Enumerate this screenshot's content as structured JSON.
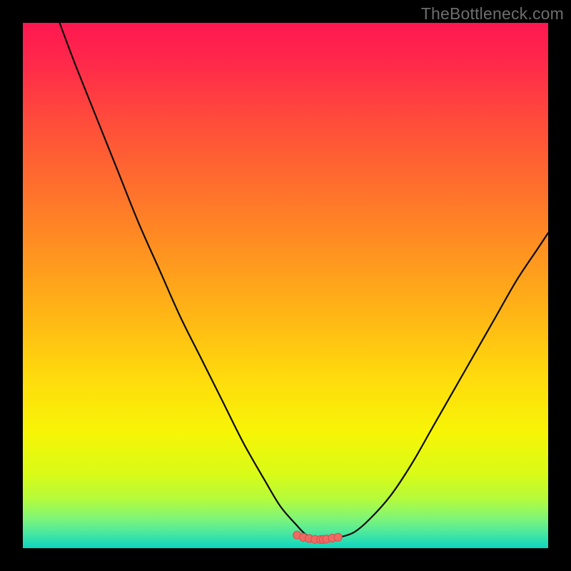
{
  "watermark": {
    "text": "TheBottleneck.com"
  },
  "colors": {
    "frame": "#000000",
    "watermark": "#6d6d6d",
    "curve": "#0b0b0b",
    "marker_fill": "#ee6a62",
    "marker_stroke": "#d84e4e",
    "gradient_stops": [
      {
        "offset": 0.0,
        "color": "#ff1750"
      },
      {
        "offset": 0.08,
        "color": "#ff2a4a"
      },
      {
        "offset": 0.18,
        "color": "#ff4a3c"
      },
      {
        "offset": 0.3,
        "color": "#ff6c2e"
      },
      {
        "offset": 0.42,
        "color": "#ff8e22"
      },
      {
        "offset": 0.55,
        "color": "#ffb416"
      },
      {
        "offset": 0.68,
        "color": "#ffdc0c"
      },
      {
        "offset": 0.78,
        "color": "#f7f506"
      },
      {
        "offset": 0.86,
        "color": "#d8fb18"
      },
      {
        "offset": 0.905,
        "color": "#b6fb3a"
      },
      {
        "offset": 0.925,
        "color": "#9af95a"
      },
      {
        "offset": 0.945,
        "color": "#7cf47a"
      },
      {
        "offset": 0.965,
        "color": "#56eb97"
      },
      {
        "offset": 0.985,
        "color": "#2cdfb0"
      },
      {
        "offset": 1.0,
        "color": "#0dd4c0"
      }
    ]
  },
  "chart_data": {
    "type": "line",
    "title": "",
    "xlabel": "",
    "ylabel": "",
    "xlim": [
      0,
      100
    ],
    "ylim": [
      0,
      100
    ],
    "x": [
      7,
      10,
      14,
      18,
      22,
      26,
      30,
      34,
      38,
      42,
      46,
      49,
      52,
      54,
      56,
      58,
      60,
      63,
      66,
      70,
      74,
      78,
      82,
      86,
      90,
      94,
      98,
      100
    ],
    "y": [
      100,
      92,
      82,
      72,
      62,
      53,
      44,
      36,
      28,
      20,
      13,
      8,
      4.5,
      2.5,
      1.8,
      1.6,
      2.0,
      3.0,
      5.5,
      10,
      16,
      23,
      30,
      37,
      44,
      51,
      57,
      60
    ],
    "flat_region_x": [
      52,
      60
    ],
    "markers_x": [
      52.2,
      53.4,
      54.5,
      55.6,
      56.7,
      57.2,
      57.8,
      58.9,
      60.0
    ],
    "markers_y": [
      2.5,
      2.05,
      1.83,
      1.67,
      1.65,
      1.65,
      1.73,
      1.9,
      2.08
    ]
  }
}
